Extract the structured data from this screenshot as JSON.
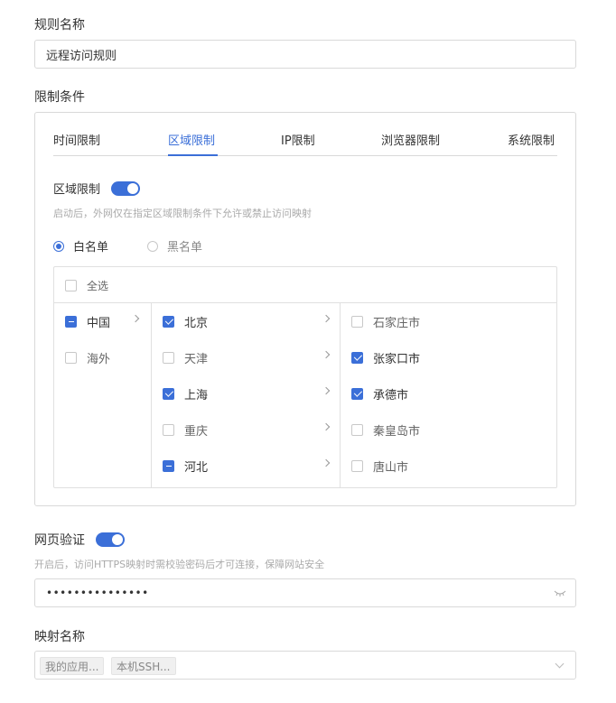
{
  "rule_name": {
    "label": "规则名称",
    "value": "远程访问规则"
  },
  "restrictions": {
    "label": "限制条件",
    "tabs": [
      {
        "label": "时间限制",
        "active": false
      },
      {
        "label": "区域限制",
        "active": true
      },
      {
        "label": "IP限制",
        "active": false
      },
      {
        "label": "浏览器限制",
        "active": false
      },
      {
        "label": "系统限制",
        "active": false
      }
    ],
    "region_switch": {
      "label": "区域限制",
      "on": true
    },
    "region_hint": "启动后，外网仅在指定区域限制条件下允许或禁止访问映射",
    "list_mode": {
      "whitelist": "白名单",
      "blacklist": "黑名单",
      "selected": "whitelist"
    },
    "cascader": {
      "select_all": "全选",
      "col1": [
        {
          "label": "中国",
          "state": "half",
          "has_children": true
        },
        {
          "label": "海外",
          "state": "none",
          "has_children": false
        }
      ],
      "col2": [
        {
          "label": "北京",
          "state": "checked"
        },
        {
          "label": "天津",
          "state": "none"
        },
        {
          "label": "上海",
          "state": "checked"
        },
        {
          "label": "重庆",
          "state": "none"
        },
        {
          "label": "河北",
          "state": "half"
        }
      ],
      "col3": [
        {
          "label": "石家庄市",
          "state": "none"
        },
        {
          "label": "张家口市",
          "state": "checked"
        },
        {
          "label": "承德市",
          "state": "checked"
        },
        {
          "label": "秦皇岛市",
          "state": "none"
        },
        {
          "label": "唐山市",
          "state": "none"
        }
      ]
    }
  },
  "web_auth": {
    "label": "网页验证",
    "on": true,
    "hint": "开启后，访问HTTPS映射时需校验密码后才可连接，保障网站安全",
    "password_mask": "•••••••••••••••"
  },
  "mapping_name": {
    "label": "映射名称",
    "tags": [
      "我的应用...",
      "本机SSH..."
    ]
  },
  "colors": {
    "accent": "#3b6fd8",
    "border": "#d9d9d9"
  },
  "icons": {
    "password_toggle": "eye-closed-icon",
    "select_arrow": "chevron-down-icon"
  }
}
